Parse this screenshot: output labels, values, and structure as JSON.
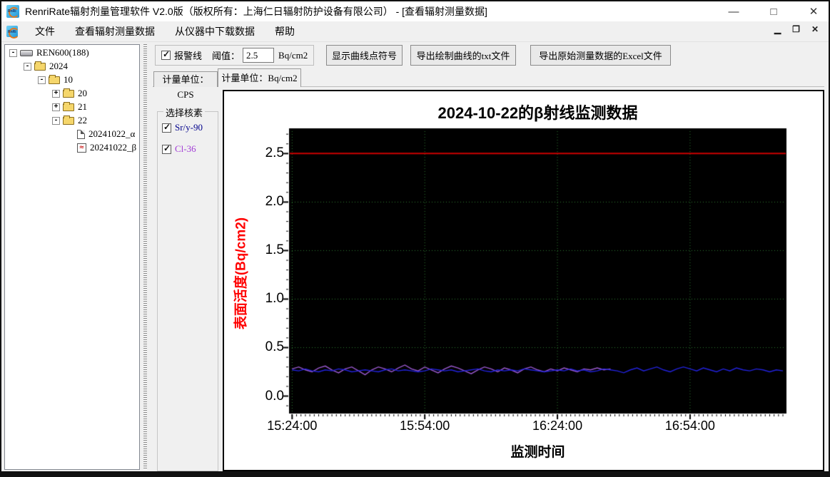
{
  "window": {
    "title": "RenriRate辐射剂量管理软件 V2.0版（版权所有：上海仁日辐射防护设备有限公司） - [查看辐射测量数据]",
    "controls": {
      "minimize": "—",
      "maximize": "□",
      "close": "✕"
    }
  },
  "menu": {
    "items": [
      "文件",
      "查看辐射测量数据",
      "从仪器中下载数据",
      "帮助"
    ],
    "child_controls": [
      "▁",
      "❐",
      "✕"
    ]
  },
  "tree": {
    "items": [
      {
        "label": "REN600(188)",
        "level": 0,
        "expander": "minus",
        "icon": "device"
      },
      {
        "label": "2024",
        "level": 1,
        "expander": "minus",
        "icon": "folder"
      },
      {
        "label": "10",
        "level": 2,
        "expander": "minus",
        "icon": "folder"
      },
      {
        "label": "20",
        "level": 3,
        "expander": "plus",
        "icon": "folder"
      },
      {
        "label": "21",
        "level": 3,
        "expander": "plus",
        "icon": "folder"
      },
      {
        "label": "22",
        "level": 3,
        "expander": "minus",
        "icon": "folder"
      },
      {
        "label": "20241022_α",
        "level": 4,
        "expander": "none",
        "icon": "doc"
      },
      {
        "label": "20241022_β",
        "level": 4,
        "expander": "none",
        "icon": "chartdoc"
      }
    ]
  },
  "toolbar": {
    "alarm_checkbox_label": "报警线",
    "alarm_checked": true,
    "threshold_label": "阈值：",
    "threshold_value": "2.5",
    "threshold_unit": "Bq/cm2",
    "show_points_button": "显示曲线点符号",
    "export_txt_button": "导出绘制曲线的txt文件",
    "export_excel_button": "导出原始测量数据的Excel文件"
  },
  "tabs": [
    {
      "label": "计量单位：CPS",
      "active": false
    },
    {
      "label": "计量单位：Bq/cm2",
      "active": true
    }
  ],
  "nuclide_panel": {
    "title": "选择核素",
    "items": [
      {
        "label": "Sr/y-90",
        "checked": true,
        "color": "#00008B"
      },
      {
        "label": "Cl-36",
        "checked": true,
        "color": "#A23BD6"
      }
    ]
  },
  "chart_data": {
    "type": "line",
    "title": "2024-10-22的β射线监测数据",
    "xlabel": "监测时间",
    "ylabel": "表面活度(Bq/cm2)",
    "ylabel_color": "#FF0000",
    "plot_background": "#000000",
    "grid": {
      "color": "#2E7D32",
      "style": "dotted",
      "on": true
    },
    "ylim": [
      -0.18,
      2.76
    ],
    "y_ticks": [
      0.0,
      0.5,
      1.0,
      1.5,
      2.0,
      2.5
    ],
    "y_minor_step": 0.1,
    "xlim_minutes": [
      -0.7,
      111.8
    ],
    "x_ticks": [
      {
        "minute": 0,
        "label": "15:24:00"
      },
      {
        "minute": 30,
        "label": "15:54:00"
      },
      {
        "minute": 60,
        "label": "16:24:00"
      },
      {
        "minute": 90,
        "label": "16:54:00"
      }
    ],
    "x_minor_step_minutes": 1,
    "alarm_line": {
      "value": 2.5,
      "color": "#CC0000"
    },
    "series": [
      {
        "name": "Sr/y-90",
        "color": "#2222DD",
        "start_minute": 0,
        "step_minutes": 1.5,
        "values": [
          0.27,
          0.26,
          0.28,
          0.26,
          0.25,
          0.27,
          0.26,
          0.28,
          0.27,
          0.25,
          0.26,
          0.27,
          0.26,
          0.25,
          0.27,
          0.28,
          0.26,
          0.27,
          0.26,
          0.25,
          0.26,
          0.28,
          0.27,
          0.26,
          0.27,
          0.25,
          0.26,
          0.27,
          0.28,
          0.26,
          0.25,
          0.27,
          0.26,
          0.27,
          0.26,
          0.28,
          0.27,
          0.26,
          0.25,
          0.26,
          0.27,
          0.26,
          0.28,
          0.26,
          0.27,
          0.25,
          0.26,
          0.28,
          0.27,
          0.26,
          0.24,
          0.27,
          0.29,
          0.26,
          0.28,
          0.3,
          0.27,
          0.25,
          0.28,
          0.3,
          0.28,
          0.26,
          0.29,
          0.27,
          0.25,
          0.28,
          0.26,
          0.29,
          0.27,
          0.26,
          0.28,
          0.27,
          0.25,
          0.27,
          0.26
        ]
      },
      {
        "name": "Cl-36",
        "color": "#9B59D0",
        "start_minute": 0,
        "step_minutes": 1.5,
        "values": [
          0.28,
          0.3,
          0.27,
          0.25,
          0.29,
          0.31,
          0.27,
          0.24,
          0.28,
          0.3,
          0.26,
          0.22,
          0.27,
          0.3,
          0.28,
          0.25,
          0.29,
          0.32,
          0.28,
          0.26,
          0.3,
          0.27,
          0.24,
          0.28,
          0.31,
          0.29,
          0.26,
          0.23,
          0.27,
          0.3,
          0.28,
          0.25,
          0.29,
          0.27,
          0.24,
          0.28,
          0.3,
          0.27,
          0.25,
          0.28,
          0.26,
          0.29,
          0.27,
          0.25,
          0.28,
          0.27,
          0.29,
          0.27,
          0.28
        ]
      }
    ]
  }
}
